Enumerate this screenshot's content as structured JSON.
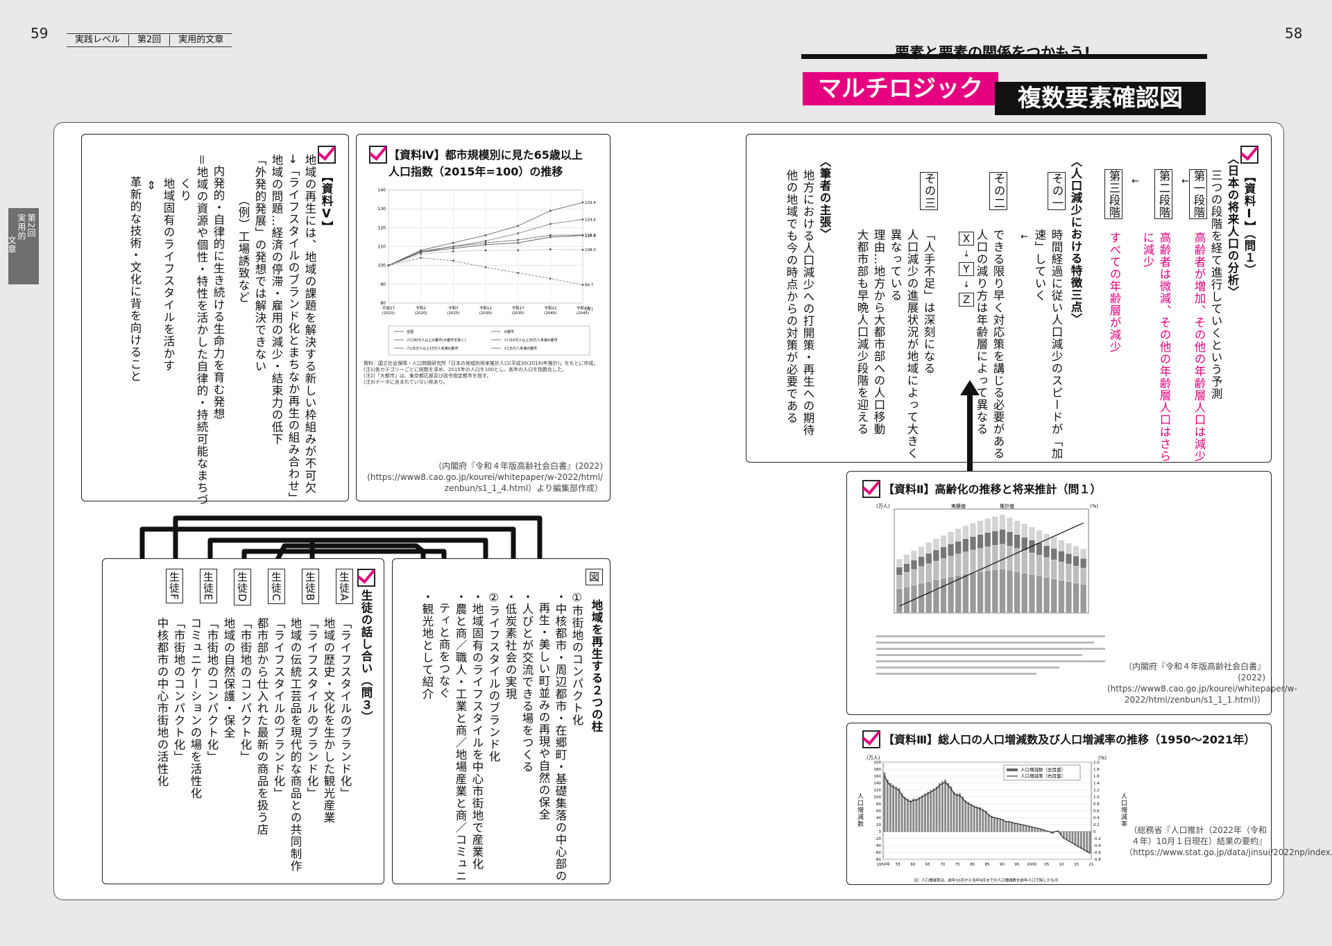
{
  "page": {
    "left_page_number": "59",
    "right_page_number": "58",
    "header_tabs": [
      "実践レベル",
      "第2回",
      "実用的文章"
    ],
    "side_tab": {
      "line1": "第2回",
      "line2": "実用的",
      "line3": "文章"
    }
  },
  "banner": {
    "subtitle": "要素と要素の関係をつかもう!",
    "pink_title": "マルチロジック",
    "black_title": "複数要素確認図"
  },
  "material1": {
    "heading": "【資料Ⅰ】（問１）",
    "section": "〈日本の将来人口の分析〉",
    "lead": "三つの段階を経て進行していくという予測",
    "stage1_label": "第一段階",
    "stage1_text": "高齢者が増加、その他の年齢層人口は減少",
    "stage2_label": "第二段階",
    "stage2_text_a": "高齢者は微減、その他の年齢層人口はさら",
    "stage2_text_b": "に減少",
    "stage3_label": "第三段階",
    "stage3_text": "すべての年齢層が減少",
    "features_heading": "〈人口減少における特徴三点〉",
    "f1_label": "その一",
    "f1_text_a": "時間経過に従い人口減少のスピードが「加",
    "f1_text_b": "速」していく",
    "f2_label": "その二",
    "f2_text_a": "できる限り早く対応策を講じる必要がある",
    "f2_text_b": "人口の減り方は年齢層によって異なる",
    "xyz": [
      "X",
      "Y",
      "Z"
    ],
    "f3_label": "その三",
    "f3_text_a": "「人手不足」は深刻になる",
    "f3_text_b": "人口減少の進展状況が地域によって大きく",
    "f3_text_c": "異なっている",
    "f3_text_d": "理由…地方から大都市部への人口移動",
    "f3_text_e": "大都市部も早晩人口減少段階を迎える",
    "author_heading": "〈筆者の主張〉",
    "author_text_a": "地方における人口減少への打開策・再生への期待",
    "author_text_b": "他の地域でも今の時点からの対策が必要である"
  },
  "material2": {
    "heading": "【資料Ⅱ】高齢化の推移と将来推計（問１）",
    "source": "（内閣府『令和４年版高齢社会白書』(2022) (https://www8.cao.go.jp/kourei/whitepaper/w-2022/html/zenbun/s1_1_1.html)）",
    "y_axis_left": "(万人)",
    "y_axis_right": "(%)",
    "legend_a": "実績値",
    "legend_b": "推計値"
  },
  "material3": {
    "heading": "【資料Ⅲ】総人口の人口増減数及び人口増減率の推移（1950～2021年）",
    "source": "（総務省『人口推計（2022年（令和４年）10月１日現在）結果の要約』（https://www.stat.go.jp/data/jinsui/2022np/index.html））",
    "y_left_label": "人口増減数",
    "y_right_label": "人口増減率",
    "legend_a": "人口増減数（左目盛）",
    "legend_b": "人口増減率（右目盛）",
    "unit_left": "(万人)",
    "unit_right": "(%)",
    "footnote": "注）人口増減率は、前年10月から当年9月までの人口増減数を前年人口で除したもの"
  },
  "material4": {
    "heading_a": "【資料Ⅳ】都市規模別に見た65歳以上",
    "heading_b": "人口指数（2015年=100）の推移",
    "source_a": "（内閣府『令和４年版高齢社会白書』(2022)",
    "source_b": "(https://www8.cao.go.jp/kourei/whitepaper/w-2022/html/",
    "source_c": "zenbun/s1_1_4.html）より編集部作成）",
    "note1": "資料：国立社会保障・人口問題研究所「日本の地域別将来推計人口(平成30(2018)年推計)」をもとに作成。",
    "note2": "(注1)各カテゴリーごとに総数を求め、2015年の人口を100とし、各年の人口を指数化した。",
    "note3": "(注2)「大都市」は、東京都区部及び政令指定都市を指す。",
    "note4": "(注3)データに含まれていない県あり。",
    "legend": [
      "全国",
      "大都市",
      "人口30万人以上の都市(大都市を除く)",
      "人口10万人以上30万人未満の都市",
      "人口5万人以上10万人未満の都市",
      "人口5万人未満の都市"
    ],
    "x_unit": "(年)"
  },
  "material5": {
    "heading": "【資料Ⅴ】",
    "l1": "地域の再生には、地域の課題を解決する新しい枠組みが不可欠",
    "l2": "→「ライフスタイルのブランド化とまちなか再生の組み合わせ」",
    "l3": "地域の問題…経済の停滞・雇用の減少・結束力の低下",
    "l4": "「外発的発展」の発想では解決できない",
    "l5": "（例）工場誘致など",
    "l6": "内発的・自律的に生き続ける生命力を育む発想",
    "l7": "＝地域の資源や個性・特性を活かした自律的・持続可能なまちづ",
    "l8": "くり",
    "l9": "地域固有のライフスタイルを活かす",
    "l10": "⇔",
    "l11": "革新的な技術・文化に背を向けること"
  },
  "figure": {
    "tag": "図",
    "title": "地域を再生する２つの柱",
    "p1_a": "①市街地のコンパクト化",
    "p1_b": "・中核都市・周辺都市・在郷町・基礎集落の中心部の",
    "p1_c": "再生・美しい町並みの再現や自然の保全",
    "p1_d": "・人びとが交流できる場をつくる",
    "p1_e": "・低炭素社会の実現",
    "p2_a": "②ライフスタイルのブランド化",
    "p2_b": "・地域固有のライフスタイルを中心市街地で産業化",
    "p2_c": "・農と商／職人・工業と商／地場産業と商／コミュニ",
    "p2_d": "ティと商をつなぐ",
    "p2_e": "・観光地として紹介"
  },
  "students": {
    "heading": "生徒の話し合い（問３）",
    "A_tag": "生徒A",
    "A_a": "「ライフスタイルのブランド化」",
    "A_b": "地域の歴史・文化を生かした観光産業",
    "B_tag": "生徒B",
    "B_a": "「ライフスタイルのブランド化」",
    "B_b": "地域の伝統工芸品を現代的な商品との共同制作",
    "C_tag": "生徒C",
    "C_a": "「ライフスタイルのブランド化」",
    "C_b": "都市部から仕入れた最新の商品を扱う店",
    "D_tag": "生徒D",
    "D_a": "「市街地のコンパクト化」",
    "D_b": "地域の自然保護・保全",
    "E_tag": "生徒E",
    "E_a": "「市街地のコンパクト化」",
    "E_b": "コミュニケーションの場を活性化",
    "F_tag": "生徒F",
    "F_a": "「市街地のコンパクト化」",
    "F_b": "中核都市の中心市街地の活性化"
  },
  "chart_data": [
    {
      "type": "line",
      "title": "都市規模別に見た65歳以上人口指数（2015年=100）の推移",
      "x": [
        "平成27\n(2015)",
        "令和2\n(2020)",
        "令和7\n(2025)",
        "令和12\n(2030)",
        "令和17\n(2035)",
        "令和22\n(2040)",
        "令和27\n(2045)"
      ],
      "ylim": [
        80,
        140
      ],
      "yticks": [
        80,
        90,
        100,
        110,
        120,
        130,
        140
      ],
      "series": [
        {
          "values": [
            100,
            108,
            112,
            116,
            121,
            129,
            133.4
          ],
          "end_label": "133.4"
        },
        {
          "values": [
            100,
            107,
            110,
            113,
            117,
            122,
            124.4
          ],
          "end_label": "124.4"
        },
        {
          "values": [
            100,
            107.5,
            110,
            112,
            113.5,
            116,
            116.1
          ],
          "end_label": "116.1"
        },
        {
          "values": [
            100,
            107,
            109,
            111,
            112,
            115,
            115.9
          ],
          "end_label": "115.9"
        },
        {
          "values": [
            100,
            106,
            107.5,
            108,
            108,
            108.5,
            108.3
          ],
          "end_label": "108.3"
        },
        {
          "values": [
            100,
            104,
            102.5,
            99,
            96,
            93,
            89.7
          ],
          "end_label": "89.7"
        }
      ]
    },
    {
      "type": "bar",
      "title": "人口増減数",
      "x_start": 1950,
      "x_ticks": [
        "1950年",
        "55",
        "60",
        "65",
        "70",
        "75",
        "80",
        "85",
        "90",
        "95",
        "2000",
        "05",
        "10",
        "15",
        "21"
      ],
      "ylim": [
        -80,
        200
      ],
      "yticks": [
        200,
        180,
        160,
        140,
        120,
        100,
        80,
        60,
        40,
        20,
        0,
        -20,
        -40,
        -60,
        -80
      ],
      "y2lim": [
        -0.8,
        2.0
      ],
      "y2ticks": [
        "2.0",
        "1.8",
        "1.6",
        "1.4",
        "1.2",
        "1.0",
        "0.8",
        "0.6",
        "0.4",
        "0.2",
        "0",
        "-0.2",
        "-0.4",
        "-0.6",
        "-0.8"
      ],
      "values": [
        170,
        150,
        140,
        135,
        130,
        125,
        110,
        100,
        95,
        90,
        95,
        95,
        100,
        105,
        110,
        115,
        120,
        125,
        130,
        140,
        145,
        150,
        140,
        130,
        115,
        110,
        110,
        100,
        90,
        85,
        80,
        75,
        72,
        70,
        65,
        60,
        50,
        45,
        42,
        40,
        38,
        35,
        30,
        30,
        28,
        25,
        24,
        22,
        20,
        18,
        16,
        14,
        12,
        10,
        8,
        5,
        2,
        0,
        -5,
        0,
        2,
        -10,
        -20,
        -25,
        -30,
        -35,
        -40,
        -45,
        -50,
        -55,
        -60,
        -64
      ]
    }
  ]
}
